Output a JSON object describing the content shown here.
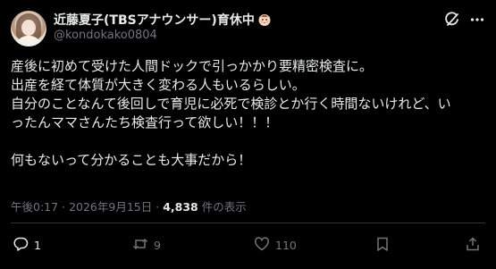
{
  "author": {
    "display_name": "近藤夏子(TBSアナウンサー)育休中",
    "handle": "@kondokako0804",
    "avatar": "profile-photo"
  },
  "post": {
    "lines": [
      "産後に初めて受けた人間ドックで引っかかり要精密検査に。",
      "出産を経て体質が大きく変わる人もいるらしい。",
      "自分のことなんて後回しで育児に必死で検診とか行く時間ないけれど、い",
      "ったんママさんたち検査行って欲しい！！！",
      "",
      "何もないって分かることも大事だから！"
    ],
    "time": "午後0:17",
    "separator": "·",
    "date": "2026年9月15日",
    "views_count": "4,838",
    "views_label": "件の表示"
  },
  "actions": {
    "reply_count": "1",
    "repost_count": "9",
    "like_count": "110",
    "bookmark_count": "",
    "icons": [
      "reply-icon",
      "repost-icon",
      "like-icon",
      "bookmark-icon",
      "share-icon"
    ]
  },
  "header_icons": [
    "grok-icon",
    "more-icon",
    "baby-face-emoji"
  ],
  "colors": {
    "background": "#000000",
    "text": "#e7e9ea",
    "muted": "#71767b",
    "divider": "#2f3336"
  }
}
